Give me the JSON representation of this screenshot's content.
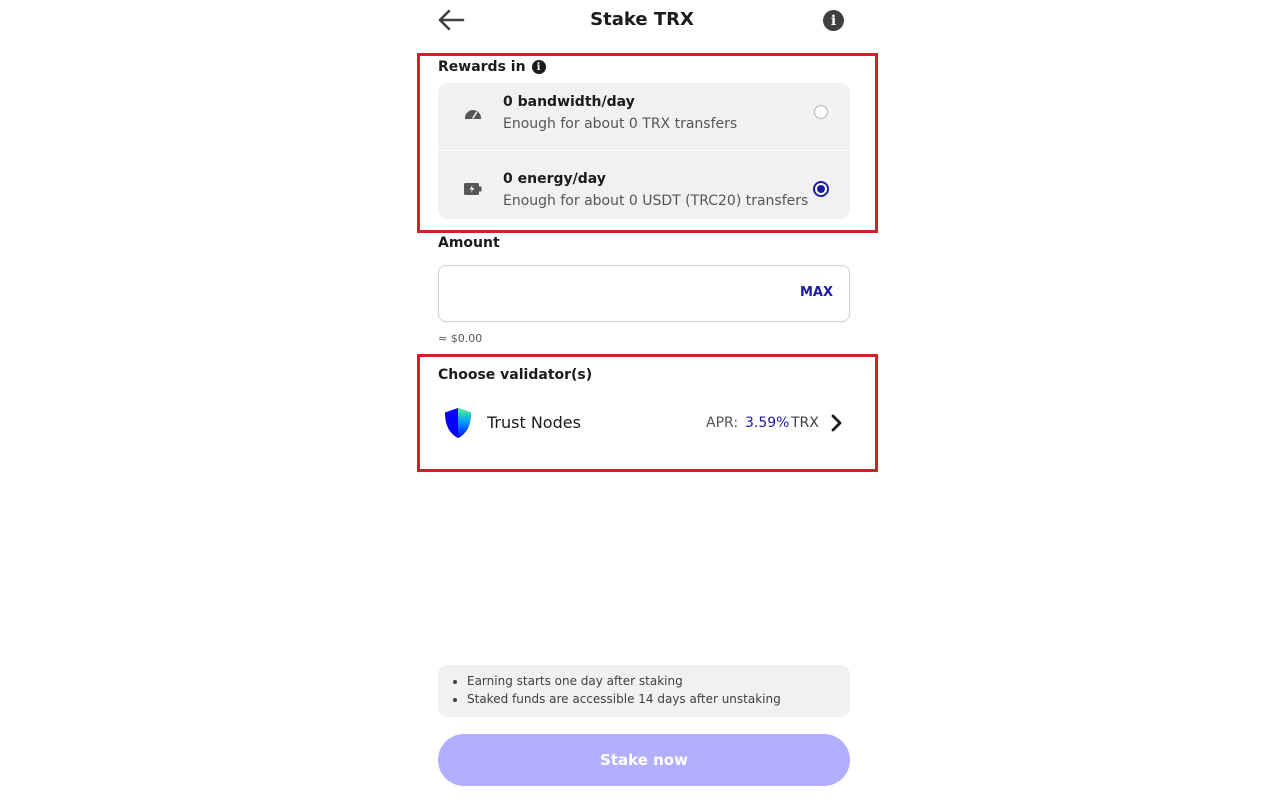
{
  "header": {
    "title": "Stake TRX",
    "info_icon_glyph": "i"
  },
  "rewards": {
    "label": "Rewards in",
    "info_icon_glyph": "i",
    "options": [
      {
        "title": "0 bandwidth/day",
        "subtitle": "Enough for about 0 TRX transfers",
        "icon": "gauge-icon",
        "selected": false
      },
      {
        "title": "0 energy/day",
        "subtitle": "Enough for about 0 USDT (TRC20) transfers",
        "icon": "battery-charging-icon",
        "selected": true
      }
    ]
  },
  "amount": {
    "label": "Amount",
    "value": "",
    "placeholder": "",
    "max_label": "MAX",
    "fiat_value": "≈ $0.00"
  },
  "validators": {
    "label": "Choose validator(s)",
    "selected": {
      "name": "Trust Nodes",
      "apr_label": "APR:",
      "apr_value": "3.59%",
      "currency": "TRX",
      "icon": "trust-shield-icon"
    }
  },
  "notes": [
    "Earning starts one day after staking",
    "Staked funds are accessible 14 days after unstaking"
  ],
  "stake_button": {
    "label": "Stake now",
    "enabled": false
  },
  "colors": {
    "accent": "#1d1c9e",
    "button_disabled": "#b3afff",
    "card_bg": "#f1f1f3",
    "highlight": "#d0202a"
  }
}
